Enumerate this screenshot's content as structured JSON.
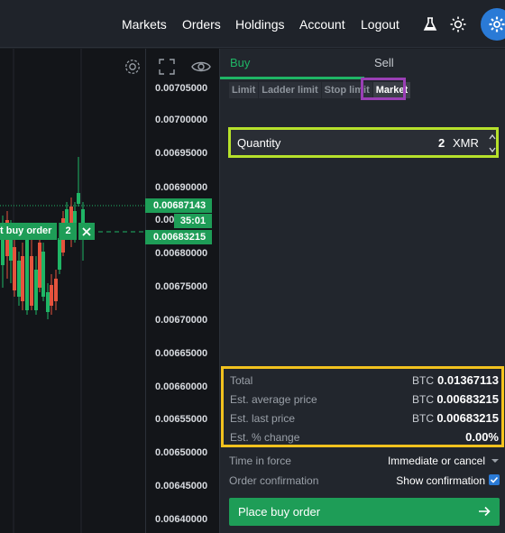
{
  "nav": {
    "links": [
      "Markets",
      "Orders",
      "Holdings",
      "Account",
      "Logout"
    ],
    "icons": [
      "flask-icon",
      "sun-icon",
      "gear-icon"
    ]
  },
  "chart": {
    "y_axis_labels": [
      "0.00705000",
      "0.00700000",
      "0.00695000",
      "0.00690000",
      "0.00685000",
      "0.00680000",
      "0.00675000",
      "0.00670000",
      "0.00665000",
      "0.00660000",
      "0.00655000",
      "0.00650000",
      "0.00645000",
      "0.00640000"
    ],
    "last_price_tag": "0.00687143",
    "timer_tag": "35:01",
    "order_price_tag": "0.00683215",
    "order_tag_label": "t buy order",
    "order_tag_qty": "2",
    "colors": {
      "up": "#1fb565",
      "down": "#e5533d",
      "tag": "#1e9d57"
    }
  },
  "chart_data": {
    "type": "candlestick",
    "y_axis": {
      "range": [
        0.0064,
        0.00705
      ],
      "unit": "BTC"
    },
    "horizontal_lines": [
      {
        "value": 0.00687143,
        "label": "0.00687143",
        "style": "dotted"
      },
      {
        "value": 0.00683215,
        "label": "0.00683215",
        "style": "dashed"
      }
    ]
  },
  "panel": {
    "tabs": [
      "Buy",
      "Sell"
    ],
    "active_tab": "Buy",
    "order_types": [
      "Limit",
      "Ladder limit",
      "Stop limit",
      "Market"
    ],
    "active_order_type": "Market",
    "quantity": {
      "label": "Quantity",
      "value": "2",
      "unit": "XMR"
    },
    "summary": [
      {
        "label": "Total",
        "currency": "BTC",
        "value": "0.01367113"
      },
      {
        "label": "Est. average price",
        "currency": "BTC",
        "value": "0.00683215"
      },
      {
        "label": "Est. last price",
        "currency": "BTC",
        "value": "0.00683215"
      },
      {
        "label": "Est. % change",
        "currency": "",
        "value": "0.00%"
      }
    ],
    "time_in_force": {
      "label": "Time in force",
      "value": "Immediate or cancel"
    },
    "order_confirmation": {
      "label": "Order confirmation",
      "value": "Show confirmation",
      "checked": true
    },
    "place_button": "Place buy order"
  },
  "highlights": {
    "purple": "#9a3fb5",
    "green": "#b6e12b",
    "yellow": "#f2c21e"
  }
}
